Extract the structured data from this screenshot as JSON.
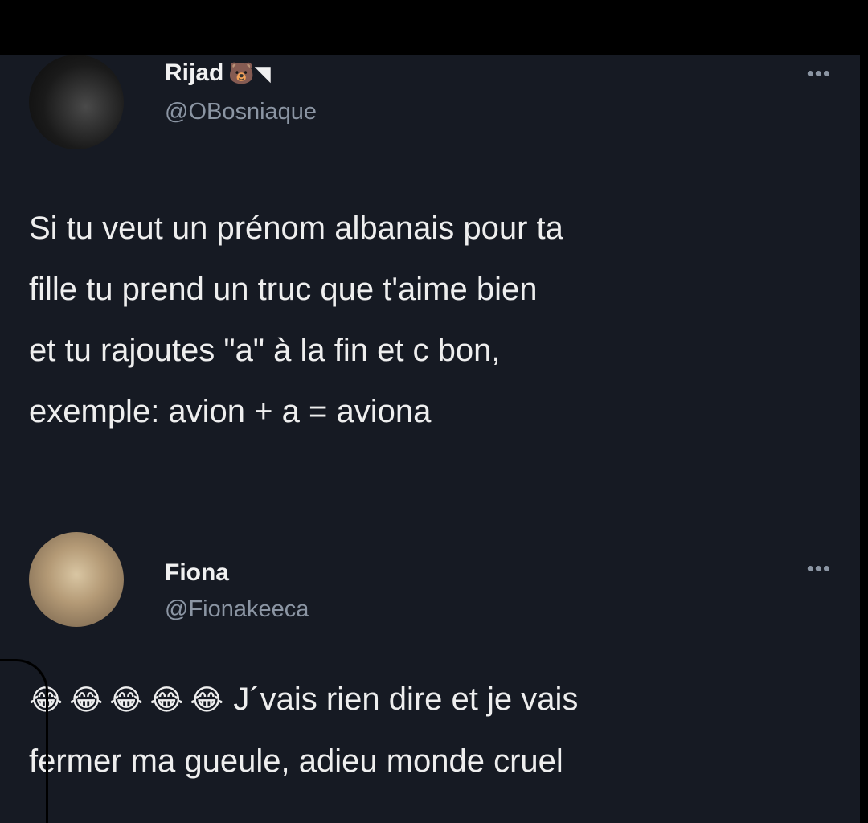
{
  "tweets": [
    {
      "name": "Rijad",
      "badge": "🐻◥",
      "handle": "@OBosniaque",
      "more": "•••",
      "lines": [
        "Si tu veut un prénom albanais pour ta",
        "fille tu prend un truc que t'aime bien",
        "et tu rajoutes \"a\" à la fin et c bon,",
        "exemple: avion + a = aviona"
      ]
    },
    {
      "name": "Fiona",
      "handle": "@Fionakeeca",
      "more": "•••",
      "emoji": "😂😂😂😂😂",
      "lines": [
        "J´vais rien dire et je vais",
        "fermer ma gueule, adieu monde cruel"
      ]
    }
  ],
  "icons": {
    "more": "more-horizontal-icon",
    "emoji": "face-with-tears-of-joy"
  },
  "colors": {
    "background": "#161a23",
    "text": "#eeeeee",
    "secondary": "#8b95a3"
  }
}
